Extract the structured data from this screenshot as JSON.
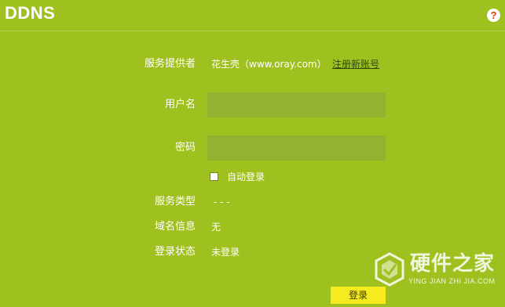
{
  "header": {
    "title": "DDNS",
    "help_symbol": "?"
  },
  "form": {
    "provider": {
      "label": "服务提供者",
      "value": "花生壳（www.oray.com）",
      "register_link": "注册新账号"
    },
    "username": {
      "label": "用户名",
      "value": ""
    },
    "password": {
      "label": "密码",
      "value": ""
    },
    "auto_login": {
      "label": "自动登录",
      "checked": false
    },
    "service_type": {
      "label": "服务类型",
      "value": "- - -"
    },
    "domain_info": {
      "label": "域名信息",
      "value": "无"
    },
    "login_status": {
      "label": "登录状态",
      "value": "未登录"
    },
    "login_button": "登录"
  },
  "watermark": {
    "name": "硬件之家",
    "subtitle": "YING JIAN ZHI JIA.COM"
  },
  "colors": {
    "background": "#9fc11f",
    "input_bg": "#94b22f",
    "button_bg": "#f7ea1e",
    "help_icon": "#e03a16",
    "link": "#2f4a10"
  },
  "icons": {
    "help": "help-icon",
    "watermark_logo": "hexagon-check-logo"
  }
}
